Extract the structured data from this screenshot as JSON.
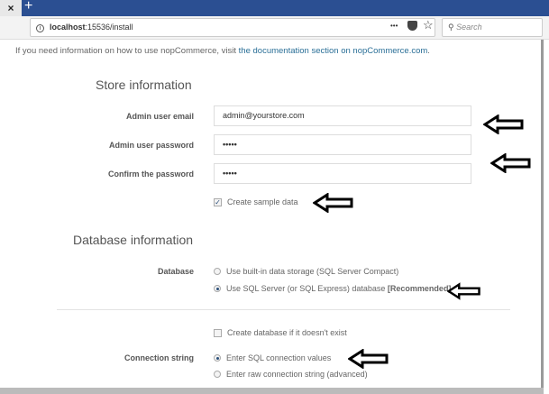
{
  "browser": {
    "close_label": "×",
    "new_tab_label": "+",
    "url_host": "localhost",
    "url_rest": ":15536/install",
    "more_label": "•••",
    "search_placeholder": "Search"
  },
  "page": {
    "info_text": "If you need information on how to use nopCommerce, visit ",
    "info_link": "the documentation section on nopCommerce.com",
    "info_end": ".",
    "store": {
      "heading": "Store information",
      "email_label": "Admin user email",
      "email_value": "admin@yourstore.com",
      "password_label": "Admin user password",
      "password_value": "•••••",
      "confirm_label": "Confirm the password",
      "confirm_value": "•••••",
      "sample_data_label": "Create sample data",
      "sample_data_checked": true
    },
    "database": {
      "heading": "Database information",
      "db_label": "Database",
      "option_compact": "Use built-in data storage (SQL Server Compact)",
      "option_sql": "Use SQL Server (or SQL Express) database",
      "option_sql_tag": "[Recommended]",
      "create_db_label": "Create database if it doesn't exist",
      "conn_label": "Connection string",
      "conn_option_values": "Enter SQL connection values",
      "conn_option_raw": "Enter raw connection string (advanced)"
    }
  }
}
